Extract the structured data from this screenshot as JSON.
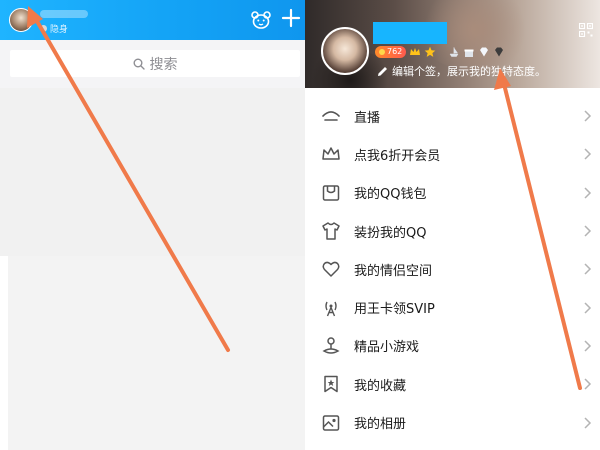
{
  "left": {
    "status_text": "隐身",
    "search": {
      "label": "搜索"
    }
  },
  "right": {
    "level_number": "762",
    "signature": "编辑个签，展示我的独特态度。",
    "menu": [
      {
        "label": "直播",
        "icon": "live-icon"
      },
      {
        "label": "点我6折开会员",
        "icon": "crown-icon"
      },
      {
        "label": "我的QQ钱包",
        "icon": "wallet-icon"
      },
      {
        "label": "装扮我的QQ",
        "icon": "shirt-icon"
      },
      {
        "label": "我的情侣空间",
        "icon": "heart-icon"
      },
      {
        "label": "用王卡领SVIP",
        "icon": "antenna-icon"
      },
      {
        "label": "精品小游戏",
        "icon": "joystick-icon"
      },
      {
        "label": "我的收藏",
        "icon": "bookmark-icon"
      },
      {
        "label": "我的相册",
        "icon": "photo-icon"
      }
    ]
  },
  "colors": {
    "header_blue": "#13a2f5",
    "annotation_arrow": "#f07a4a",
    "icon_gray": "#555555"
  }
}
